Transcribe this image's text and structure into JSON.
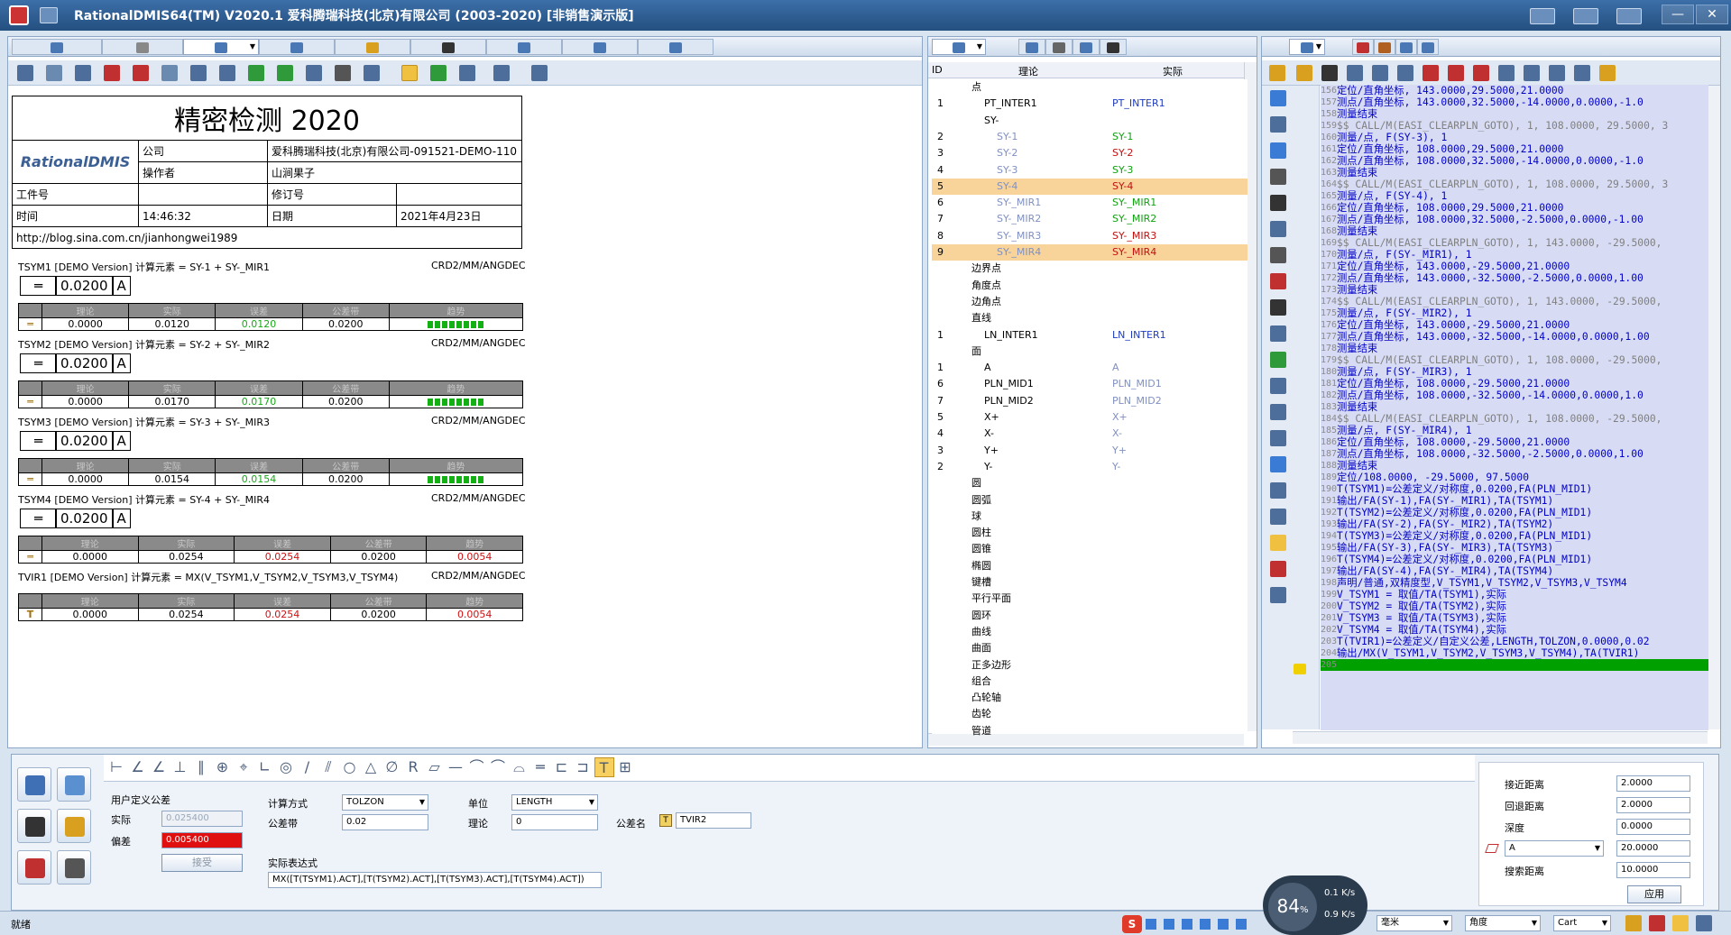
{
  "window": {
    "title": "RationalDMIS64(TM) V2020.1   爱科腾瑞科技(北京)有限公司 (2003-2020) [非销售演示版]",
    "min": "—",
    "max": "□",
    "close": "✕"
  },
  "report": {
    "title": "精密检测  2020",
    "logo": "RationalDMIS",
    "company_label": "公司",
    "company_value": "爱科腾瑞科技(北京)有限公司-091521-DEMO-110",
    "operator_label": "操作者",
    "operator_value": "山涧果子",
    "part_label": "工件号",
    "rev_label": "修订号",
    "time_label": "时间",
    "time_value": "14:46:32",
    "date_label": "日期",
    "date_value": "2021年4月23日",
    "url": "http://blog.sina.com.cn/jianhongwei1989"
  },
  "table_headers": [
    "理论",
    "实际",
    "误差",
    "公差带",
    "趋势"
  ],
  "features": [
    {
      "line": "TSYM1    [DEMO Version]  计算元素 =  SY-1 + SY-_MIR1",
      "crd": "CRD2/MM/ANGDEC",
      "sym": "═",
      "tol": "0.0200",
      "datum": "A",
      "nominal": "0.0000",
      "actual": "0.0120",
      "dev": "0.0120",
      "tolzone": "0.0200",
      "trend": "bar"
    },
    {
      "line": "TSYM2    [DEMO Version]  计算元素 =  SY-2 + SY-_MIR2",
      "crd": "CRD2/MM/ANGDEC",
      "sym": "═",
      "tol": "0.0200",
      "datum": "A",
      "nominal": "0.0000",
      "actual": "0.0170",
      "dev": "0.0170",
      "tolzone": "0.0200",
      "trend": "bar"
    },
    {
      "line": "TSYM3    [DEMO Version]  计算元素 =  SY-3 + SY-_MIR3",
      "crd": "CRD2/MM/ANGDEC",
      "sym": "═",
      "tol": "0.0200",
      "datum": "A",
      "nominal": "0.0000",
      "actual": "0.0154",
      "dev": "0.0154",
      "tolzone": "0.0200",
      "trend": "bar"
    },
    {
      "line": "TSYM4    [DEMO Version]  计算元素 =  SY-4 + SY-_MIR4",
      "crd": "CRD2/MM/ANGDEC",
      "sym": "═",
      "tol": "0.0200",
      "datum": "A",
      "nominal": "0.0000",
      "actual": "0.0254",
      "dev": "0.0254",
      "tolzone": "0.0200",
      "trend": "0.0054"
    },
    {
      "line": "TVIR1    [DEMO Version]  计算元素 =  MX(V_TSYM1,V_TSYM2,V_TSYM3,V_TSYM4)",
      "crd": "CRD2/MM/ANGDEC",
      "sym": "T",
      "tol": "",
      "datum": "",
      "nominal": "0.0000",
      "actual": "0.0254",
      "dev": "0.0254",
      "tolzone": "0.0200",
      "trend": "0.0054"
    }
  ],
  "tree": {
    "col_id": "ID",
    "col_nominal": "理论",
    "col_actual": "实际",
    "rows": [
      {
        "id": "",
        "name": "点",
        "actual": "",
        "indent": 0,
        "c": ""
      },
      {
        "id": "1",
        "name": "PT_INTER1",
        "actual": "PT_INTER1",
        "indent": 1,
        "c": "c-blue"
      },
      {
        "id": "",
        "name": "SY-",
        "actual": "",
        "indent": 1,
        "c": ""
      },
      {
        "id": "2",
        "name": "SY-1",
        "actual": "SY-1",
        "indent": 2,
        "c": "c-g"
      },
      {
        "id": "3",
        "name": "SY-2",
        "actual": "SY-2",
        "indent": 2,
        "c": "c-r"
      },
      {
        "id": "4",
        "name": "SY-3",
        "actual": "SY-3",
        "indent": 2,
        "c": "c-g"
      },
      {
        "id": "5",
        "name": "SY-4",
        "actual": "SY-4",
        "indent": 2,
        "c": "c-r",
        "hl": true
      },
      {
        "id": "6",
        "name": "SY-_MIR1",
        "actual": "SY-_MIR1",
        "indent": 2,
        "c": "c-g"
      },
      {
        "id": "7",
        "name": "SY-_MIR2",
        "actual": "SY-_MIR2",
        "indent": 2,
        "c": "c-g"
      },
      {
        "id": "8",
        "name": "SY-_MIR3",
        "actual": "SY-_MIR3",
        "indent": 2,
        "c": "c-r"
      },
      {
        "id": "9",
        "name": "SY-_MIR4",
        "actual": "SY-_MIR4",
        "indent": 2,
        "c": "c-r",
        "hl": true
      },
      {
        "id": "",
        "name": "边界点",
        "actual": "",
        "indent": 0,
        "c": ""
      },
      {
        "id": "",
        "name": "角度点",
        "actual": "",
        "indent": 0,
        "c": ""
      },
      {
        "id": "",
        "name": "边角点",
        "actual": "",
        "indent": 0,
        "c": ""
      },
      {
        "id": "",
        "name": "直线",
        "actual": "",
        "indent": 0,
        "c": ""
      },
      {
        "id": "1",
        "name": "LN_INTER1",
        "actual": "LN_INTER1",
        "indent": 1,
        "c": "c-blue"
      },
      {
        "id": "",
        "name": "面",
        "actual": "",
        "indent": 0,
        "c": ""
      },
      {
        "id": "1",
        "name": "A",
        "actual": "A",
        "indent": 1,
        "c": "c-gray"
      },
      {
        "id": "6",
        "name": "PLN_MID1",
        "actual": "PLN_MID1",
        "indent": 1,
        "c": "c-gray"
      },
      {
        "id": "7",
        "name": "PLN_MID2",
        "actual": "PLN_MID2",
        "indent": 1,
        "c": "c-gray"
      },
      {
        "id": "5",
        "name": "X+",
        "actual": "X+",
        "indent": 1,
        "c": "c-gray"
      },
      {
        "id": "4",
        "name": "X-",
        "actual": "X-",
        "indent": 1,
        "c": "c-gray"
      },
      {
        "id": "3",
        "name": "Y+",
        "actual": "Y+",
        "indent": 1,
        "c": "c-gray"
      },
      {
        "id": "2",
        "name": "Y-",
        "actual": "Y-",
        "indent": 1,
        "c": "c-gray"
      },
      {
        "id": "",
        "name": "圆",
        "actual": "",
        "indent": 0,
        "c": ""
      },
      {
        "id": "",
        "name": "圆弧",
        "actual": "",
        "indent": 0,
        "c": ""
      },
      {
        "id": "",
        "name": "球",
        "actual": "",
        "indent": 0,
        "c": ""
      },
      {
        "id": "",
        "name": "圆柱",
        "actual": "",
        "indent": 0,
        "c": ""
      },
      {
        "id": "",
        "name": "圆锥",
        "actual": "",
        "indent": 0,
        "c": ""
      },
      {
        "id": "",
        "name": "椭圆",
        "actual": "",
        "indent": 0,
        "c": ""
      },
      {
        "id": "",
        "name": "键槽",
        "actual": "",
        "indent": 0,
        "c": ""
      },
      {
        "id": "",
        "name": "平行平面",
        "actual": "",
        "indent": 0,
        "c": ""
      },
      {
        "id": "",
        "name": "圆环",
        "actual": "",
        "indent": 0,
        "c": ""
      },
      {
        "id": "",
        "name": "曲线",
        "actual": "",
        "indent": 0,
        "c": ""
      },
      {
        "id": "",
        "name": "曲面",
        "actual": "",
        "indent": 0,
        "c": ""
      },
      {
        "id": "",
        "name": "正多边形",
        "actual": "",
        "indent": 0,
        "c": ""
      },
      {
        "id": "",
        "name": "组合",
        "actual": "",
        "indent": 0,
        "c": ""
      },
      {
        "id": "",
        "name": "凸轮轴",
        "actual": "",
        "indent": 0,
        "c": ""
      },
      {
        "id": "",
        "name": "齿轮",
        "actual": "",
        "indent": 0,
        "c": ""
      },
      {
        "id": "",
        "name": "管道",
        "actual": "",
        "indent": 0,
        "c": ""
      }
    ]
  },
  "code": [
    {
      "n": "156",
      "t": "  定位/直角坐标, 143.0000,29.5000,21.0000",
      "k": "k1"
    },
    {
      "n": "157",
      "t": "  测点/直角坐标, 143.0000,32.5000,-14.0000,0.0000,-1.0",
      "k": "k1"
    },
    {
      "n": "158",
      "t": "测量结束",
      "k": "k1"
    },
    {
      "n": "159",
      "t": "$$ CALL/M(EASI_CLEARPLN_GOTO), 1, 108.0000, 29.5000, 3",
      "k": "k2"
    },
    {
      "n": "160",
      "t": "测量/点, F(SY-3), 1",
      "k": "k1"
    },
    {
      "n": "161",
      "t": "  定位/直角坐标, 108.0000,29.5000,21.0000",
      "k": "k1"
    },
    {
      "n": "162",
      "t": "  测点/直角坐标, 108.0000,32.5000,-14.0000,0.0000,-1.0",
      "k": "k1"
    },
    {
      "n": "163",
      "t": "测量结束",
      "k": "k1"
    },
    {
      "n": "164",
      "t": "$$ CALL/M(EASI_CLEARPLN_GOTO), 1, 108.0000, 29.5000, 3",
      "k": "k2"
    },
    {
      "n": "165",
      "t": "测量/点, F(SY-4), 1",
      "k": "k1"
    },
    {
      "n": "166",
      "t": "  定位/直角坐标, 108.0000,29.5000,21.0000",
      "k": "k1"
    },
    {
      "n": "167",
      "t": "  测点/直角坐标, 108.0000,32.5000,-2.5000,0.0000,-1.00",
      "k": "k1"
    },
    {
      "n": "168",
      "t": "测量结束",
      "k": "k1"
    },
    {
      "n": "169",
      "t": "$$ CALL/M(EASI_CLEARPLN_GOTO), 1, 143.0000, -29.5000,",
      "k": "k2"
    },
    {
      "n": "170",
      "t": "测量/点, F(SY-_MIR1), 1",
      "k": "k1"
    },
    {
      "n": "171",
      "t": "  定位/直角坐标, 143.0000,-29.5000,21.0000",
      "k": "k1"
    },
    {
      "n": "172",
      "t": "  测点/直角坐标, 143.0000,-32.5000,-2.5000,0.0000,1.00",
      "k": "k1"
    },
    {
      "n": "173",
      "t": "测量结束",
      "k": "k1"
    },
    {
      "n": "174",
      "t": "$$ CALL/M(EASI_CLEARPLN_GOTO), 1, 143.0000, -29.5000,",
      "k": "k2"
    },
    {
      "n": "175",
      "t": "测量/点, F(SY-_MIR2), 1",
      "k": "k1"
    },
    {
      "n": "176",
      "t": "  定位/直角坐标, 143.0000,-29.5000,21.0000",
      "k": "k1"
    },
    {
      "n": "177",
      "t": "  测点/直角坐标, 143.0000,-32.5000,-14.0000,0.0000,1.00",
      "k": "k1"
    },
    {
      "n": "178",
      "t": "测量结束",
      "k": "k1"
    },
    {
      "n": "179",
      "t": "$$ CALL/M(EASI_CLEARPLN_GOTO), 1, 108.0000, -29.5000,",
      "k": "k2"
    },
    {
      "n": "180",
      "t": "测量/点, F(SY-_MIR3), 1",
      "k": "k1"
    },
    {
      "n": "181",
      "t": "  定位/直角坐标, 108.0000,-29.5000,21.0000",
      "k": "k1"
    },
    {
      "n": "182",
      "t": "  测点/直角坐标, 108.0000,-32.5000,-14.0000,0.0000,1.0",
      "k": "k1"
    },
    {
      "n": "183",
      "t": "测量结束",
      "k": "k1"
    },
    {
      "n": "184",
      "t": "$$ CALL/M(EASI_CLEARPLN_GOTO), 1, 108.0000, -29.5000,",
      "k": "k2"
    },
    {
      "n": "185",
      "t": "测量/点, F(SY-_MIR4), 1",
      "k": "k1"
    },
    {
      "n": "186",
      "t": "  定位/直角坐标, 108.0000,-29.5000,21.0000",
      "k": "k1"
    },
    {
      "n": "187",
      "t": "  测点/直角坐标, 108.0000,-32.5000,-2.5000,0.0000,1.00",
      "k": "k1"
    },
    {
      "n": "188",
      "t": "测量结束",
      "k": "k1"
    },
    {
      "n": "189",
      "t": "定位/108.0000, -29.5000, 97.5000",
      "k": "k1"
    },
    {
      "n": "190",
      "t": "T(TSYM1)=公差定义/对称度,0.0200,FA(PLN_MID1)",
      "k": "k1"
    },
    {
      "n": "191",
      "t": "输出/FA(SY-1),FA(SY-_MIR1),TA(TSYM1)",
      "k": "k1"
    },
    {
      "n": "192",
      "t": "T(TSYM2)=公差定义/对称度,0.0200,FA(PLN_MID1)",
      "k": "k1"
    },
    {
      "n": "193",
      "t": "输出/FA(SY-2),FA(SY-_MIR2),TA(TSYM2)",
      "k": "k1"
    },
    {
      "n": "194",
      "t": "T(TSYM3)=公差定义/对称度,0.0200,FA(PLN_MID1)",
      "k": "k1"
    },
    {
      "n": "195",
      "t": "输出/FA(SY-3),FA(SY-_MIR3),TA(TSYM3)",
      "k": "k1"
    },
    {
      "n": "196",
      "t": "T(TSYM4)=公差定义/对称度,0.0200,FA(PLN_MID1)",
      "k": "k1"
    },
    {
      "n": "197",
      "t": "输出/FA(SY-4),FA(SY-_MIR4),TA(TSYM4)",
      "k": "k1"
    },
    {
      "n": "198",
      "t": "声明/普通,双精度型,V_TSYM1,V_TSYM2,V_TSYM3,V_TSYM4",
      "k": "k1"
    },
    {
      "n": "199",
      "t": "V_TSYM1 = 取值/TA(TSYM1),实际",
      "k": "k1"
    },
    {
      "n": "200",
      "t": "V_TSYM2 = 取值/TA(TSYM2),实际",
      "k": "k1"
    },
    {
      "n": "201",
      "t": "V_TSYM3 = 取值/TA(TSYM3),实际",
      "k": "k1"
    },
    {
      "n": "202",
      "t": "V_TSYM4 = 取值/TA(TSYM4),实际",
      "k": "k1"
    },
    {
      "n": "203",
      "t": "T(TVIR1)=公差定义/自定义公差,LENGTH,TOLZON,0.0000,0.02",
      "k": "k1"
    },
    {
      "n": "204",
      "t": "输出/MX(V_TSYM1,V_TSYM2,V_TSYM3,V_TSYM4),TA(TVIR1)",
      "k": "k1"
    },
    {
      "n": "205",
      "t": "",
      "k": "k1"
    }
  ],
  "tol_panel": {
    "user_tol": "用户定义公差",
    "actual_label": "实际",
    "actual_value": "0.025400",
    "dev_label": "偏差",
    "dev_value": "0.005400",
    "accept": "接受",
    "calc_label": "计算方式",
    "calc_value": "TOLZON",
    "unit_label": "单位",
    "unit_value": "LENGTH",
    "tolzone_label": "公差带",
    "tolzone_value": "0.02",
    "nominal_label": "理论",
    "nominal_value": "0",
    "name_label": "公差名",
    "name_value": "TVIR2",
    "expr_label": "实际表达式",
    "expr_value": "MX([T(TSYM1).ACT],[T(TSYM2).ACT],[T(TSYM3).ACT],[T(TSYM4).ACT])"
  },
  "probe_panel": {
    "approach_label": "接近距离",
    "approach": "2.0000",
    "retract_label": "回退距离",
    "retract": "2.0000",
    "depth_label": "深度",
    "depth": "0.0000",
    "plane": "A",
    "plane_value": "20.0000",
    "search_label": "搜索距离",
    "search": "10.0000",
    "apply": "应用"
  },
  "status": {
    "text": "就绪",
    "percent": "84",
    "pct_sign": "%",
    "up": "0.1",
    "down": "0.9",
    "unit": "K/s",
    "units": "毫米",
    "angle": "角度",
    "coord": "Cart"
  }
}
